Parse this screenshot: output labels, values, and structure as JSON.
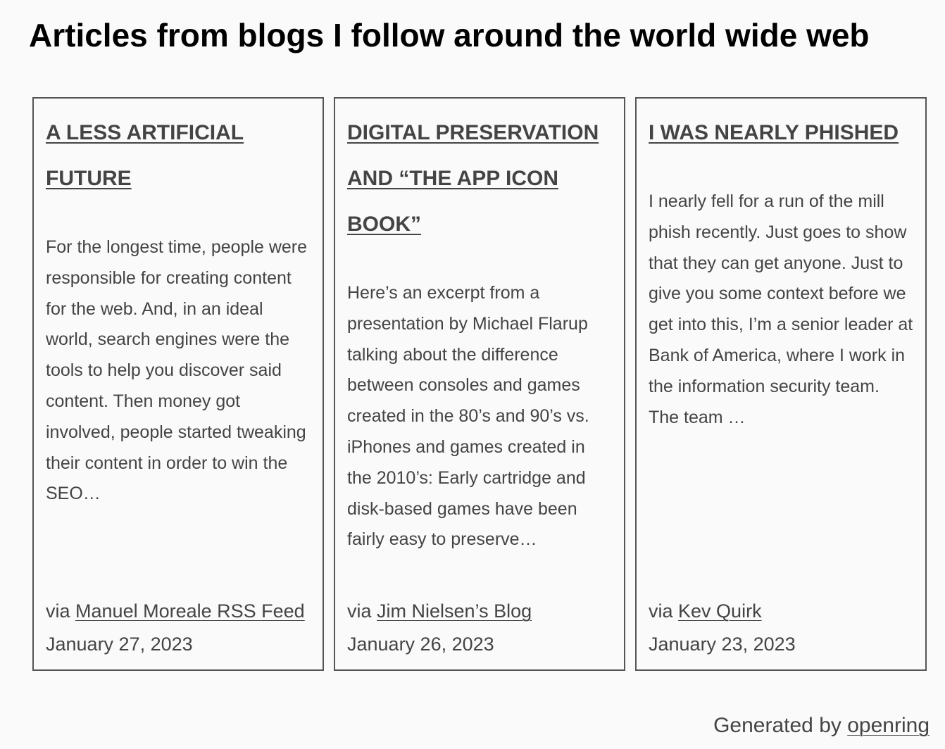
{
  "page": {
    "title": "Articles from blogs I follow around the world wide web"
  },
  "articles": [
    {
      "title": "A LESS ARTIFICIAL FUTURE",
      "summary": "For the longest time, people were responsible for creating content for the web. And, in an ideal world, search engines were the tools to help you discover said content. Then money got involved, people started tweaking their content in order to win the SEO…",
      "via": "via",
      "source": "Manuel Moreale RSS Feed",
      "date": "January 27, 2023"
    },
    {
      "title": "DIGITAL PRESERVATION AND “THE APP ICON BOOK”",
      "summary": "Here’s an excerpt from a presentation by Michael Flarup talking about the difference between consoles and games created in the 80’s and 90’s vs. iPhones and games created in the 2010’s: Early cartridge and disk-based games have been fairly easy to preserve…",
      "via": "via",
      "source": "Jim Nielsen’s Blog",
      "date": "January 26, 2023"
    },
    {
      "title": "I WAS NEARLY PHISHED",
      "summary": "I nearly fell for a run of the mill phish recently. Just goes to show that they can get anyone. Just to give you some context before we get into this, I’m a senior leader at Bank of America, where I work in the information security team. The team …",
      "via": "via",
      "source": "Kev Quirk",
      "date": "January 23, 2023"
    }
  ],
  "footer": {
    "prefix": "Generated by",
    "link": "openring"
  }
}
